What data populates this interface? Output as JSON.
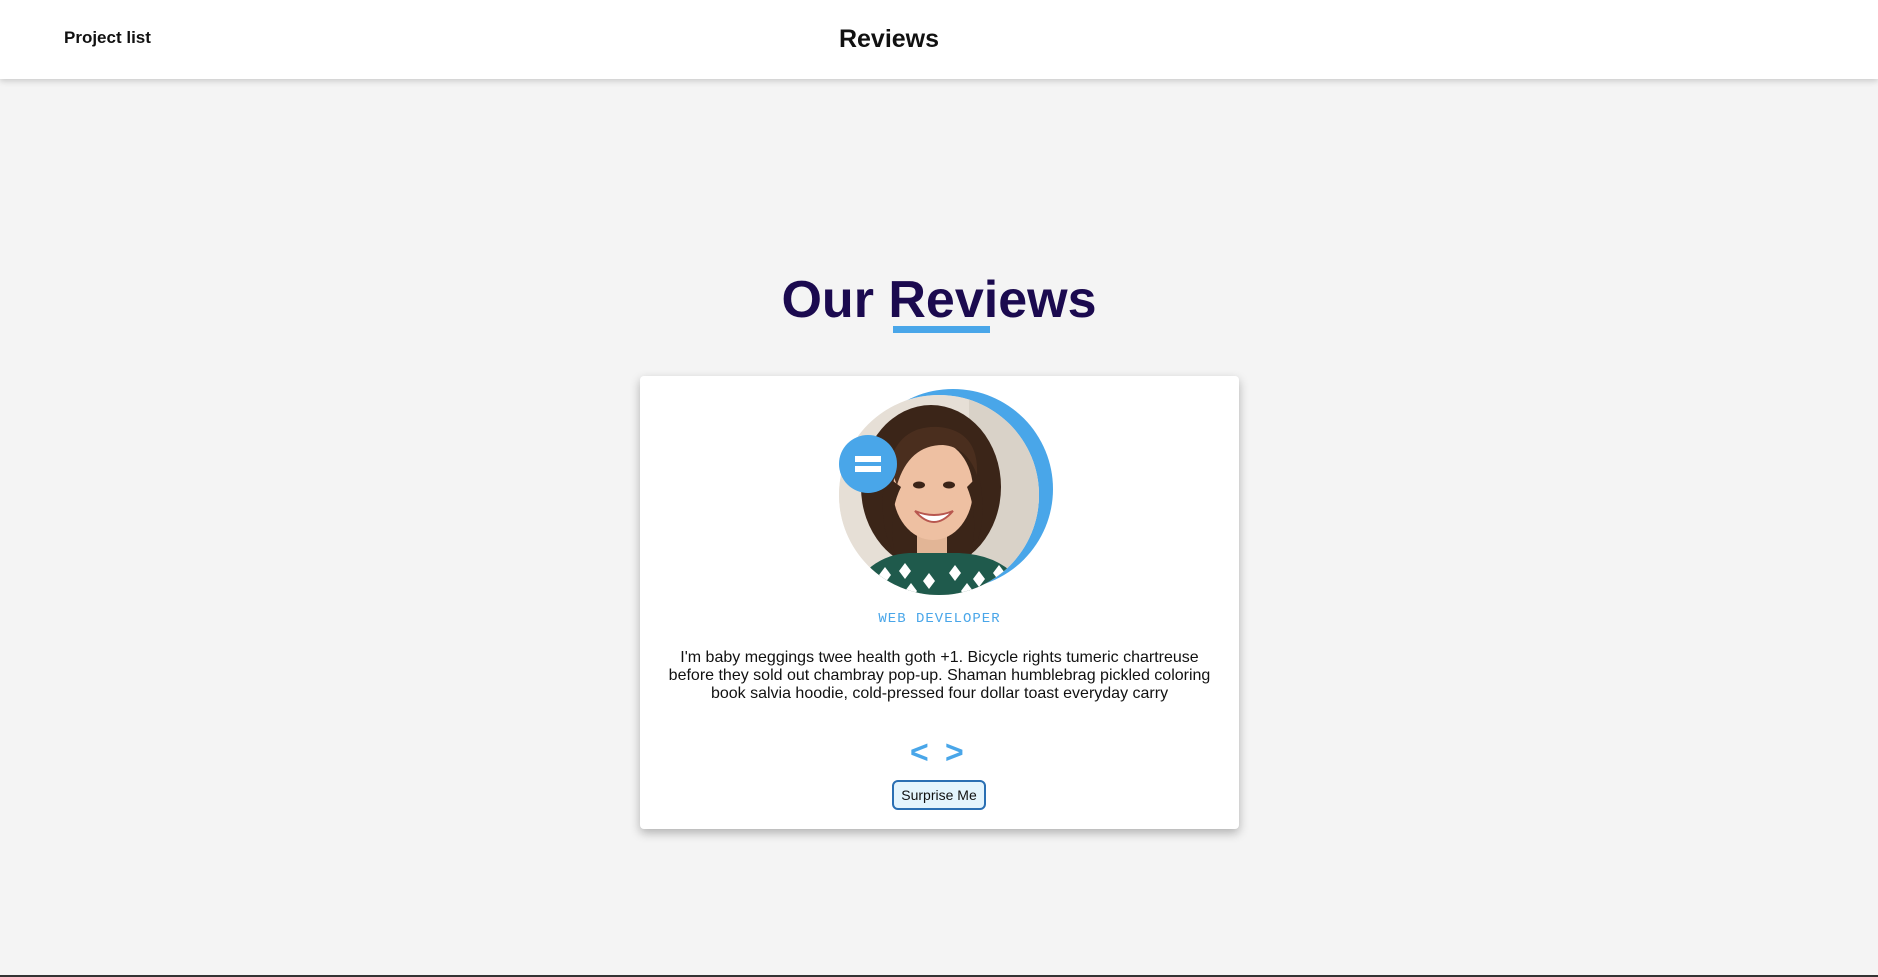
{
  "header": {
    "project_link": "Project list",
    "title": "Reviews"
  },
  "section": {
    "heading": "Our Reviews",
    "accent_color": "#49a6e9",
    "heading_color": "#1b0a4f"
  },
  "review": {
    "avatar_icon": "person-photo",
    "quote_icon": "quote-icon",
    "job": "WEB DEVELOPER",
    "text": "I'm baby meggings twee health goth +1. Bicycle rights tumeric chartreuse before they sold out chambray pop-up. Shaman humblebrag pickled coloring book salvia hoodie, cold-pressed four dollar toast everyday carry",
    "prev_label": "<",
    "next_label": ">",
    "surprise_label": "Surprise Me"
  }
}
